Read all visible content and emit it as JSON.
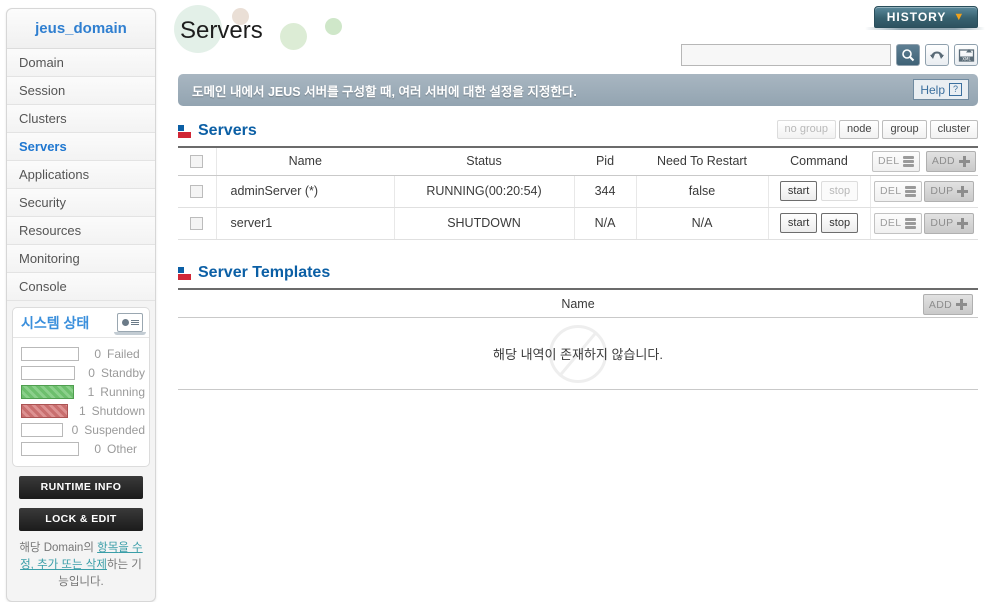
{
  "sidebar": {
    "domain_title": "jeus_domain",
    "nav_items": [
      {
        "label": "Domain",
        "active": false
      },
      {
        "label": "Session",
        "active": false
      },
      {
        "label": "Clusters",
        "active": false
      },
      {
        "label": "Servers",
        "active": true
      },
      {
        "label": "Applications",
        "active": false
      },
      {
        "label": "Security",
        "active": false
      },
      {
        "label": "Resources",
        "active": false
      },
      {
        "label": "Monitoring",
        "active": false
      },
      {
        "label": "Console",
        "active": false
      }
    ],
    "status": {
      "title": "시스템 상태",
      "icon": "monitor-chart-icon",
      "rows": [
        {
          "count": "0",
          "name": "Failed",
          "fill": "none"
        },
        {
          "count": "0",
          "name": "Standby",
          "fill": "none"
        },
        {
          "count": "1",
          "name": "Running",
          "fill": "green"
        },
        {
          "count": "1",
          "name": "Shutdown",
          "fill": "red"
        },
        {
          "count": "0",
          "name": "Suspended",
          "fill": "none"
        },
        {
          "count": "0",
          "name": "Other",
          "fill": "none"
        }
      ]
    },
    "runtime_info_label": "RUNTIME INFO",
    "lock_edit_label": "LOCK & EDIT",
    "note_part1": "해당 Domain의 ",
    "note_link1": "항목",
    "note_link2": "을 수정, 추가 또는 삭",
    "note_link3": "제",
    "note_part2": "하는 기능입니다."
  },
  "header": {
    "page_title": "Servers",
    "history_label": "HISTORY",
    "history_chevron": "chevron-down-icon",
    "search_value": "",
    "search_placeholder": "",
    "icons": [
      "search-icon",
      "refresh-icon",
      "xml-export-icon"
    ]
  },
  "info_bar": {
    "message": "도메인 내에서 JEUS 서버를 구성할 때, 여러 서버에 대한 설정을 지정한다.",
    "help_label": "Help",
    "help_icon": "question-mark-icon"
  },
  "servers_section": {
    "title": "Servers",
    "group_buttons": [
      {
        "label": "no group",
        "disabled": true
      },
      {
        "label": "node",
        "disabled": false
      },
      {
        "label": "group",
        "disabled": false
      },
      {
        "label": "cluster",
        "disabled": false
      }
    ],
    "columns": [
      "",
      "Name",
      "Status",
      "Pid",
      "Need To Restart",
      "Command",
      ""
    ],
    "header_actions": [
      {
        "label": "DEL",
        "icon": "stack-icon",
        "style": "light"
      },
      {
        "label": "ADD",
        "icon": "plus-icon",
        "style": "dark"
      }
    ],
    "rows": [
      {
        "name": "adminServer (*)",
        "status": "RUNNING(00:20:54)",
        "pid": "344",
        "need_to_restart": "false",
        "start_label": "start",
        "start_enabled": true,
        "stop_label": "stop",
        "stop_enabled": false,
        "del_label": "DEL",
        "dup_label": "DUP"
      },
      {
        "name": "server1",
        "status": "SHUTDOWN",
        "pid": "N/A",
        "need_to_restart": "N/A",
        "start_label": "start",
        "start_enabled": true,
        "stop_label": "stop",
        "stop_enabled": true,
        "del_label": "DEL",
        "dup_label": "DUP"
      }
    ]
  },
  "templates_section": {
    "title": "Server Templates",
    "column_name": "Name",
    "add_label": "ADD",
    "empty_message": "해당 내역이 존재하지 않습니다."
  },
  "colors": {
    "accent_blue": "#0b5fa5",
    "nav_active": "#1f77d0",
    "history_bg": "#37616f",
    "history_chevron": "#f0a21c",
    "info_bar_bg": "#9aaab6",
    "running_green": "#6dbf6d",
    "shutdown_red": "#c96f6f"
  }
}
